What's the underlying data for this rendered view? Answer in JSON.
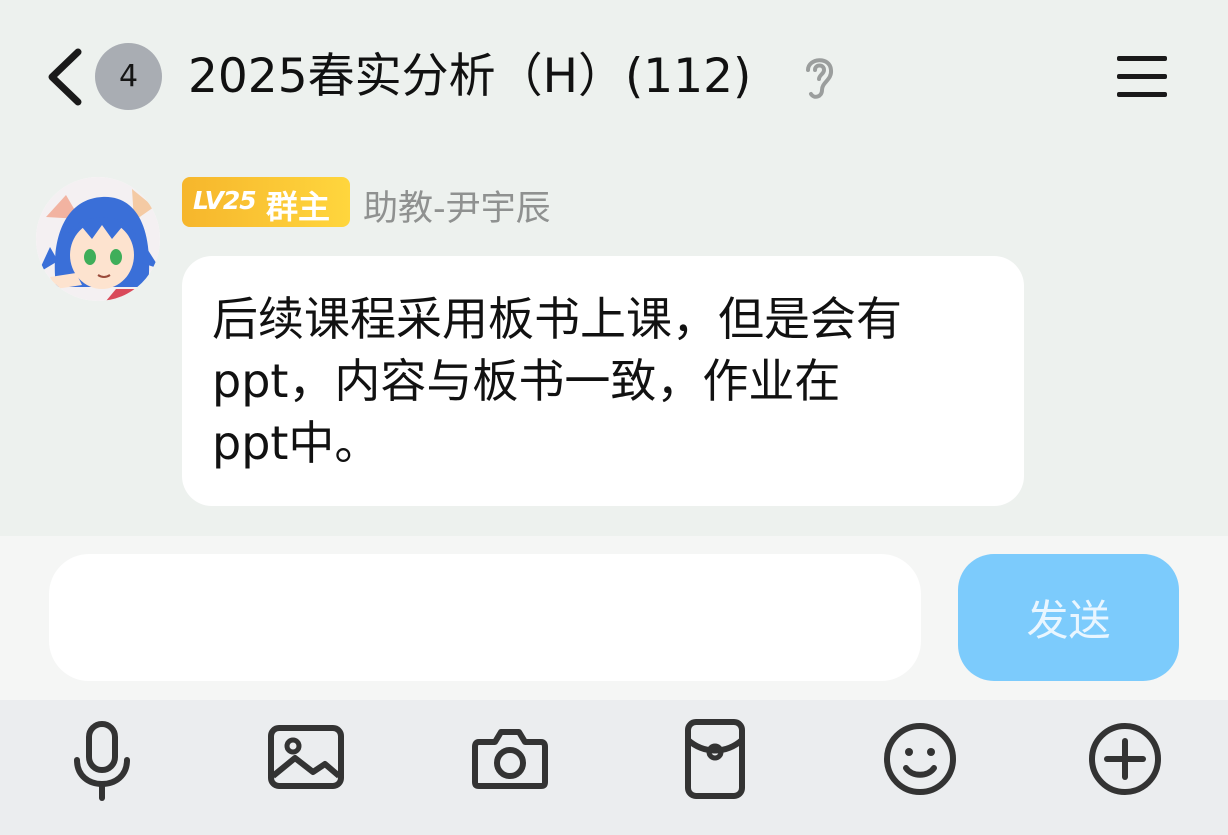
{
  "header": {
    "unread_count": "4",
    "group_title": "2025春实分析（H）(112)"
  },
  "message": {
    "level": "LV25",
    "role": "群主",
    "sender_name": "助教-尹宇辰",
    "text": "后续课程采用板书上课，但是会有\nppt，内容与板书一致，作业在\nppt中。"
  },
  "input": {
    "value": "",
    "send_label": "发送"
  },
  "colors": {
    "background": "#edf1ee",
    "send_button": "#7ccbfc",
    "level_badge": "#f6b62c",
    "bubble": "#ffffff"
  },
  "icons": {
    "back": "chevron-left-icon",
    "ear": "ear-icon",
    "menu": "hamburger-menu-icon",
    "toolbar": [
      "microphone-icon",
      "image-icon",
      "camera-icon",
      "red-packet-icon",
      "emoji-icon",
      "plus-circle-icon"
    ]
  }
}
